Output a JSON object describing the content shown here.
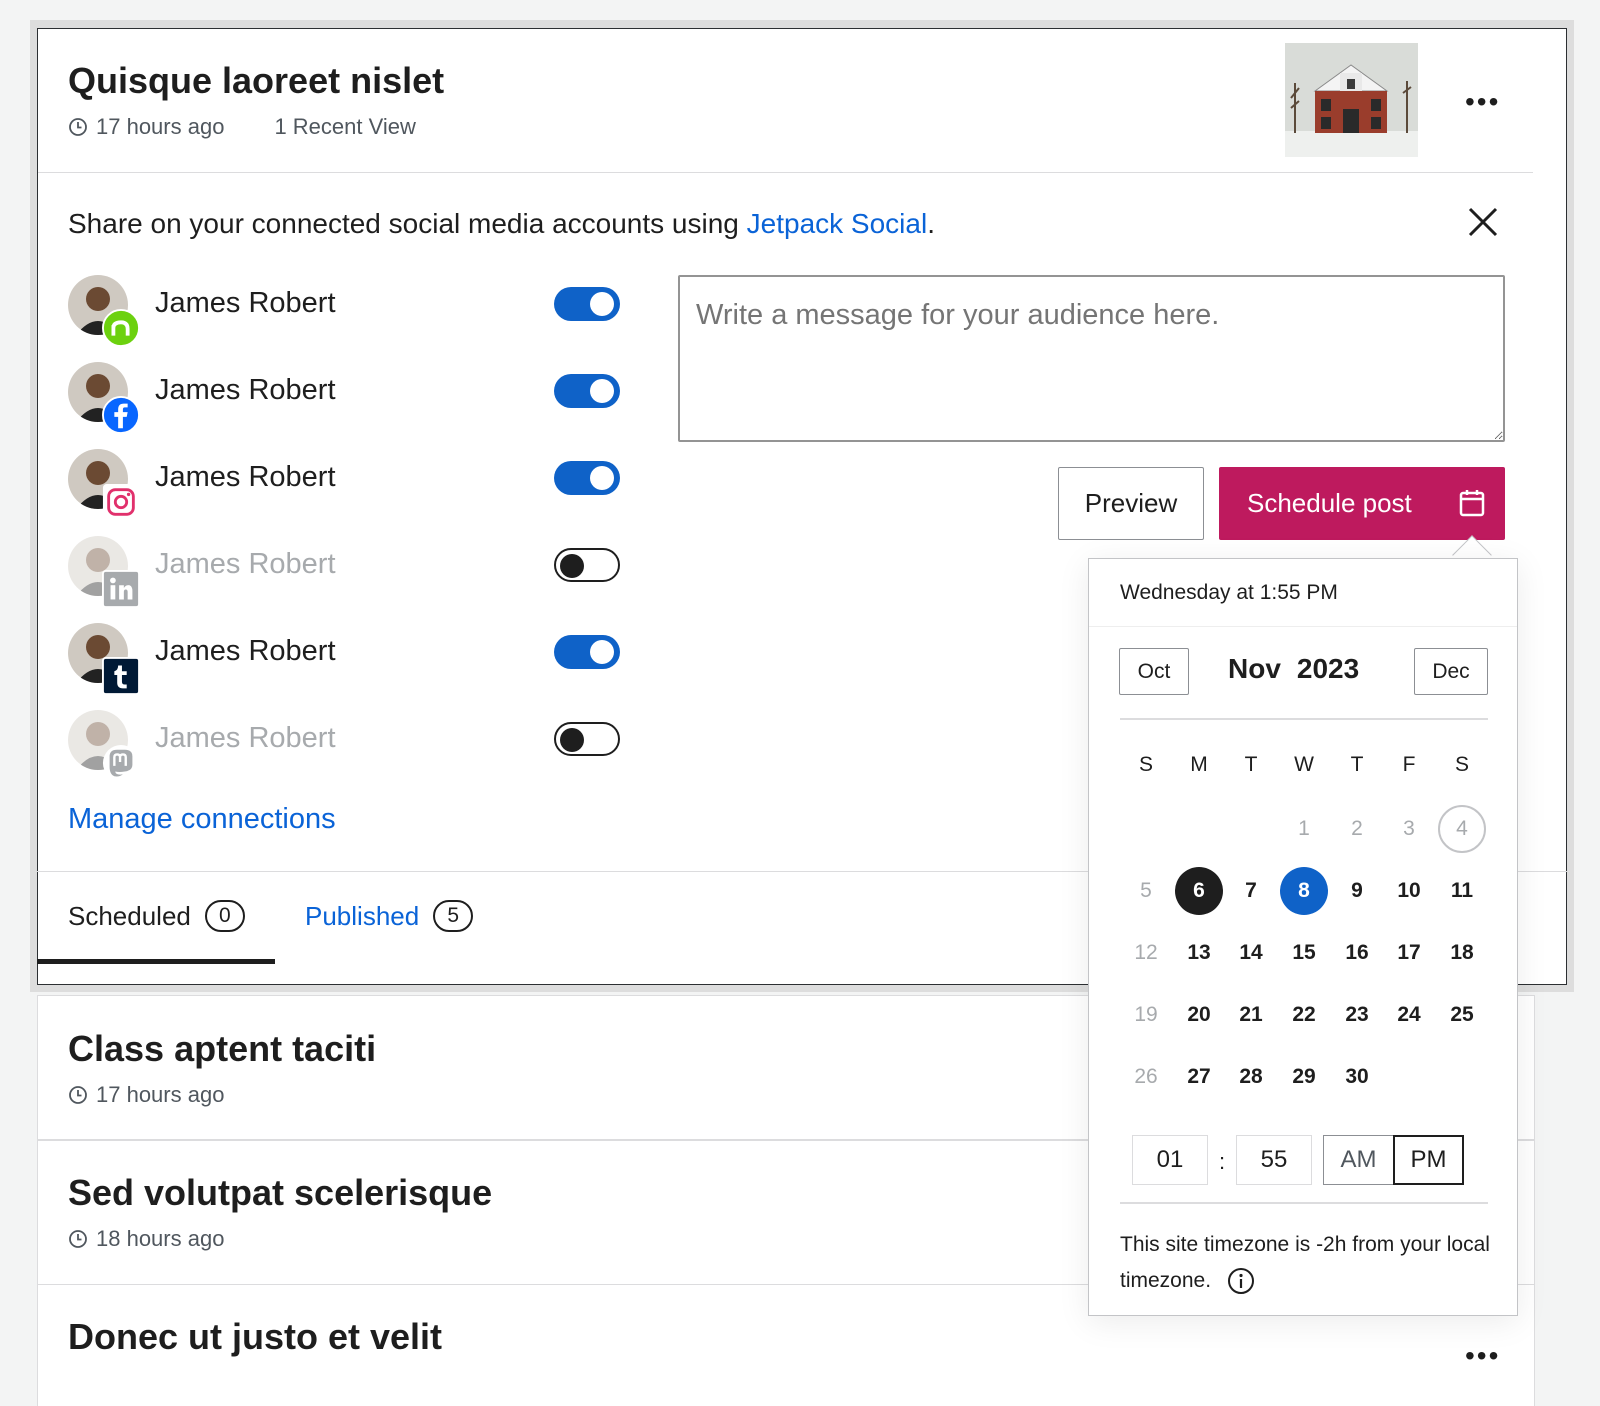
{
  "current_post": {
    "title": "Quisque laoreet nislet",
    "time_ago": "17 hours ago",
    "views": "1 Recent View",
    "more": "•••"
  },
  "share": {
    "text_prefix": "Share on your connected social media accounts using ",
    "link": "Jetpack Social",
    "text_suffix": "."
  },
  "connections": [
    {
      "name": "James Robert",
      "network": "nextdoor",
      "enabled": true
    },
    {
      "name": "James Robert",
      "network": "facebook",
      "enabled": true
    },
    {
      "name": "James Robert",
      "network": "instagram",
      "enabled": true
    },
    {
      "name": "James Robert",
      "network": "linkedin",
      "enabled": false
    },
    {
      "name": "James Robert",
      "network": "tumblr",
      "enabled": true
    },
    {
      "name": "James Robert",
      "network": "mastodon",
      "enabled": false
    }
  ],
  "message": {
    "placeholder": "Write a message for your audience here."
  },
  "buttons": {
    "preview": "Preview",
    "schedule": "Schedule post"
  },
  "manage_label": "Manage connections",
  "tabs": [
    {
      "label": "Scheduled",
      "count": "0"
    },
    {
      "label": "Published",
      "count": "5"
    }
  ],
  "posts": [
    {
      "title": "Class aptent taciti",
      "time_ago": "17 hours ago"
    },
    {
      "title": "Sed volutpat scelerisque",
      "time_ago": "18 hours ago"
    },
    {
      "title": "Donec ut justo et velit",
      "time_ago": ""
    }
  ],
  "scheduler": {
    "header": "Wednesday at 1:55 PM",
    "prev_month": "Oct",
    "month": "Nov",
    "year": "2023",
    "next_month": "Dec",
    "weekdays": [
      "S",
      "M",
      "T",
      "W",
      "T",
      "F",
      "S"
    ],
    "weeks": [
      [
        "",
        "",
        "",
        "1",
        "2",
        "3",
        "4"
      ],
      [
        "5",
        "6",
        "7",
        "8",
        "9",
        "10",
        "11"
      ],
      [
        "12",
        "13",
        "14",
        "15",
        "16",
        "17",
        "18"
      ],
      [
        "19",
        "20",
        "21",
        "22",
        "23",
        "24",
        "25"
      ],
      [
        "26",
        "27",
        "28",
        "29",
        "30",
        "",
        ""
      ]
    ],
    "hour": "01",
    "minute": "55",
    "am": "AM",
    "pm": "PM",
    "timezone_note": "This site timezone is -2h from your local timezone."
  },
  "colors": {
    "accent": "#0f62c8",
    "schedule": "#be1a5e",
    "link": "#0a63d7"
  }
}
